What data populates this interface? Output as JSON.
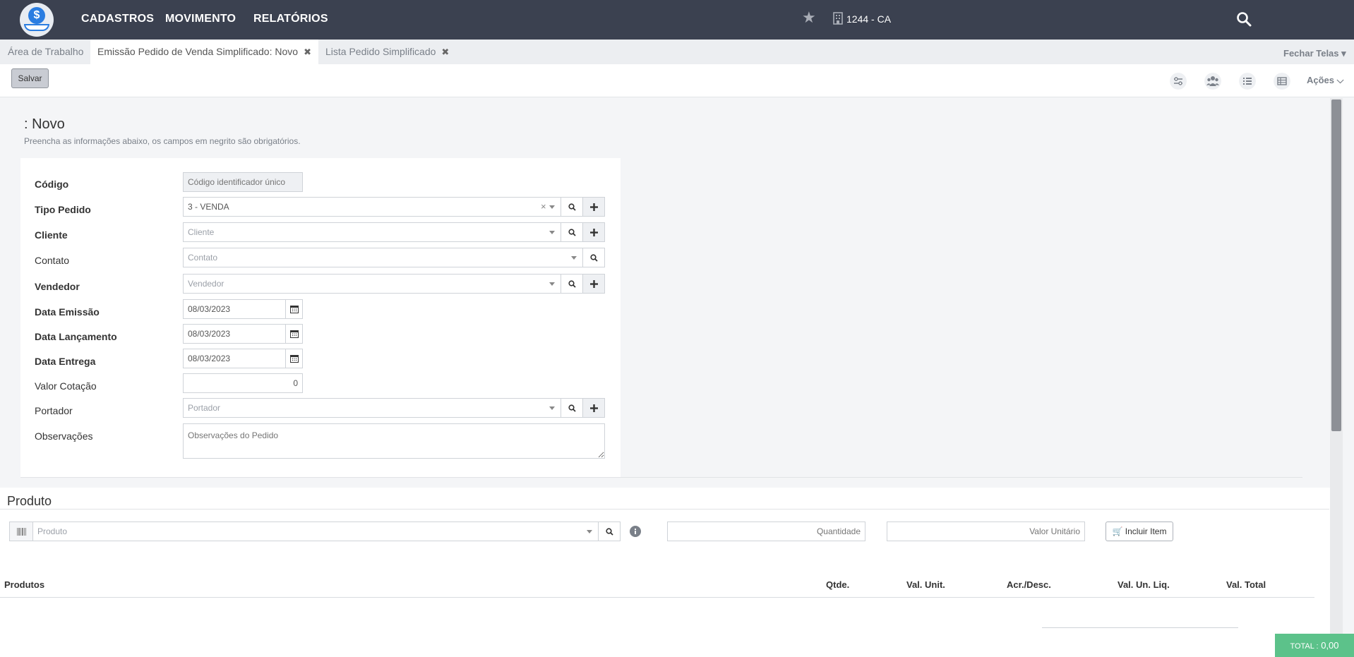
{
  "nav": {
    "items": [
      "CADASTROS",
      "MOVIMENTO",
      "RELATÓRIOS"
    ],
    "branch": "1244 - CA"
  },
  "tabs": {
    "items": [
      {
        "label": "Área de Trabalho"
      },
      {
        "label": "Emissão Pedido de Venda Simplificado: Novo"
      },
      {
        "label": "Lista Pedido Simplificado"
      }
    ],
    "close_all": "Fechar Telas"
  },
  "toolbar": {
    "save_label": "Salvar",
    "actions_label": "Ações"
  },
  "page": {
    "title": ": Novo",
    "subtitle": "Preencha as informações abaixo, os campos em negrito são obrigatórios."
  },
  "form": {
    "codigo": {
      "label": "Código",
      "placeholder": "Código identificador único"
    },
    "tipo_pedido": {
      "label": "Tipo Pedido",
      "value": "3 - VENDA",
      "clear": "×"
    },
    "cliente": {
      "label": "Cliente",
      "placeholder": "Cliente"
    },
    "contato": {
      "label": "Contato",
      "placeholder": "Contato"
    },
    "vendedor": {
      "label": "Vendedor",
      "placeholder": "Vendedor"
    },
    "data_emissao": {
      "label": "Data Emissão",
      "value": "08/03/2023"
    },
    "data_lancamento": {
      "label": "Data Lançamento",
      "value": "08/03/2023"
    },
    "data_entrega": {
      "label": "Data Entrega",
      "value": "08/03/2023"
    },
    "valor_cotacao": {
      "label": "Valor Cotação",
      "value": "0"
    },
    "portador": {
      "label": "Portador",
      "placeholder": "Portador"
    },
    "observacoes": {
      "label": "Observações",
      "placeholder": "Observações do Pedido"
    }
  },
  "produto": {
    "title": "Produto",
    "product_placeholder": "Produto",
    "quantity_placeholder": "Quantidade",
    "unit_value_placeholder": "Valor Unitário",
    "include_label": "Incluir Item",
    "columns": [
      "Produtos",
      "Qtde.",
      "Val. Unit.",
      "Acr./Desc.",
      "Val. Un. Liq.",
      "Val. Total"
    ]
  },
  "total": {
    "label": "TOTAL :",
    "value": "0,00"
  },
  "colors": {
    "topbar": "#3b4150",
    "accent": "#2a7de1",
    "total_badge": "#5cc28a"
  }
}
